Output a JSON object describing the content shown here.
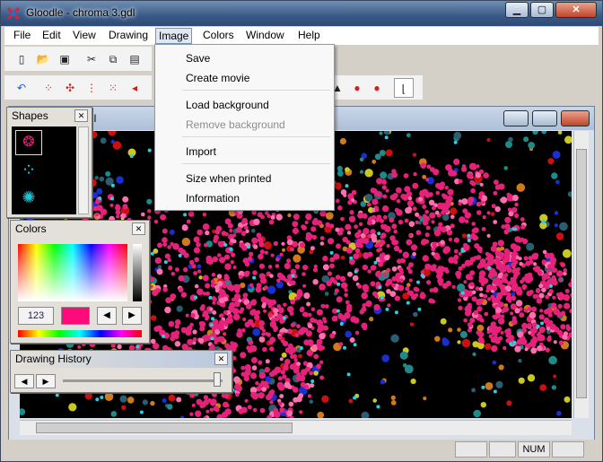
{
  "window": {
    "title": "Gloodle - chroma 3.gdl",
    "minimize_label": "▁",
    "maximize_label": "▢",
    "close_label": "✕"
  },
  "menu": [
    "File",
    "Edit",
    "View",
    "Drawing",
    "Image",
    "Colors",
    "Window",
    "Help"
  ],
  "image_menu": {
    "items": [
      {
        "label": "Save",
        "enabled": true
      },
      {
        "label": "Create movie",
        "enabled": true
      },
      {
        "label": "Load background",
        "enabled": true
      },
      {
        "label": "Remove background",
        "enabled": false
      },
      {
        "label": "Import",
        "enabled": true
      },
      {
        "label": "Size when printed",
        "enabled": true
      },
      {
        "label": "Information",
        "enabled": true
      }
    ]
  },
  "toolbar1": [
    "new-icon",
    "open-icon",
    "save-icon",
    "cut-icon",
    "copy-icon",
    "paste-icon"
  ],
  "toolbar2": [
    "undo-icon",
    "tool-a-icon",
    "tool-b-icon",
    "tool-c-icon",
    "tool-d-icon",
    "tool-e-icon",
    "tool-f-icon"
  ],
  "document": {
    "title_fragment": "dl"
  },
  "panels": {
    "shapes": {
      "title": "Shapes"
    },
    "colors": {
      "title": "Colors",
      "code_button": "123",
      "swatch": "#ff0a7a"
    },
    "history": {
      "title": "Drawing History"
    }
  },
  "status": {
    "num": "NUM"
  },
  "colors": {
    "accent_pink": "#e6217a",
    "canvas_bg": "#000000"
  }
}
